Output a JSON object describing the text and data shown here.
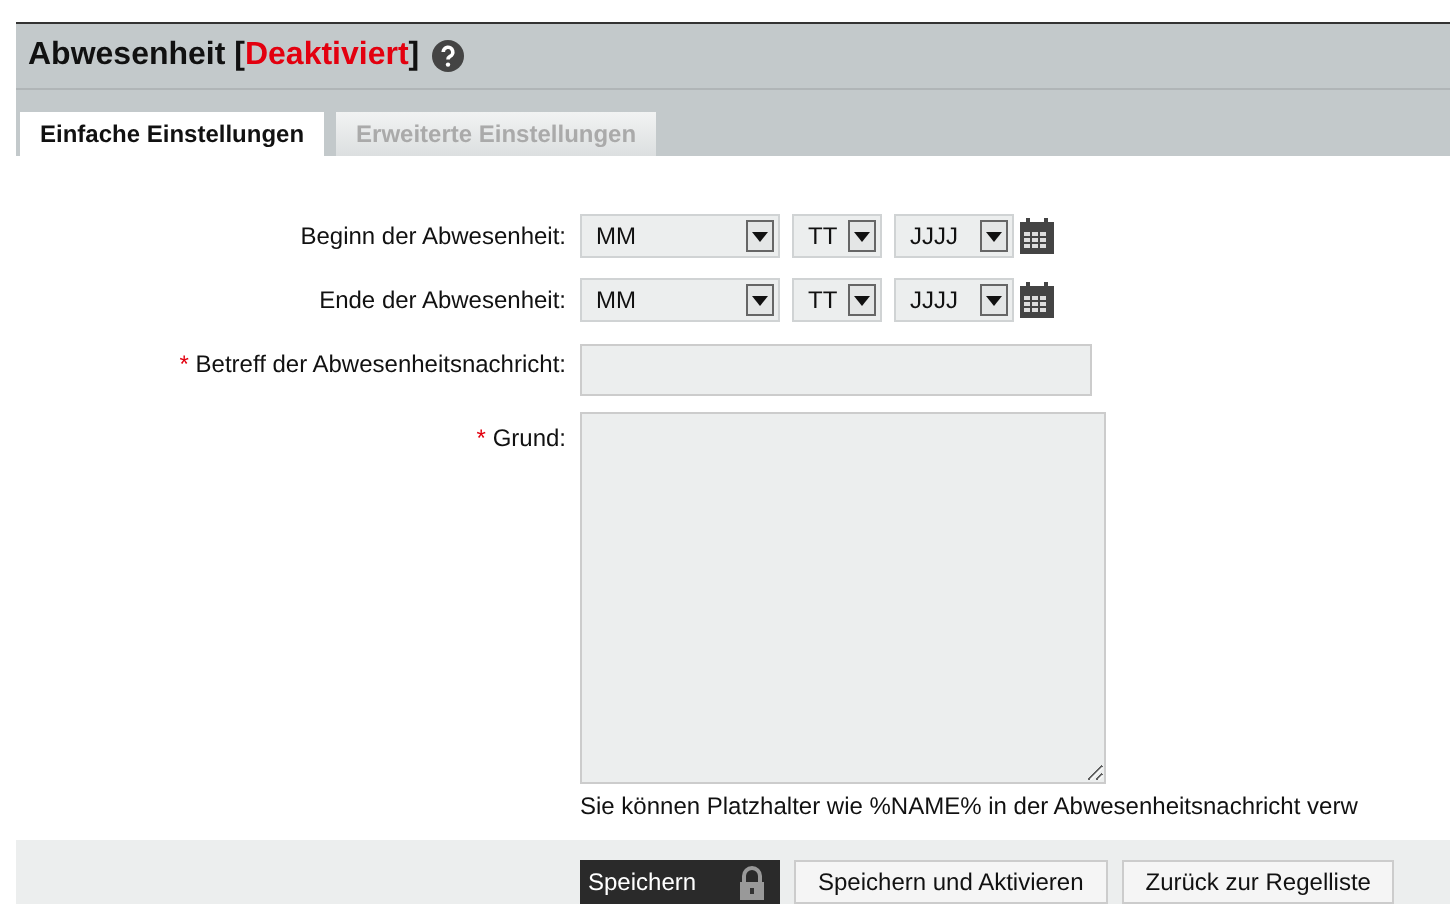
{
  "header": {
    "title": "Abwesenheit",
    "status": "Deaktiviert",
    "open_bracket": "[",
    "close_bracket": "]"
  },
  "tabs": [
    {
      "label": "Einfache Einstellungen",
      "selected": true
    },
    {
      "label": "Erweiterte Einstellungen",
      "selected": false
    }
  ],
  "fields": [
    {
      "kind": "date",
      "label": "Beginn der Abwesenheit:",
      "required": false,
      "parts": [
        "MM",
        "TT",
        "JJJJ"
      ]
    },
    {
      "kind": "date",
      "label": "Ende der Abwesenheit:",
      "required": false,
      "parts": [
        "MM",
        "TT",
        "JJJJ"
      ]
    },
    {
      "kind": "text",
      "label": "Betreff der Abwesenheitsnachricht:",
      "required": true,
      "required_mark": "*"
    },
    {
      "kind": "textarea",
      "label": "Grund:",
      "required": true,
      "required_mark": "*"
    }
  ],
  "hint": "Sie können Platzhalter wie %NAME% in der Abwesenheitsnachricht verw",
  "buttons": [
    {
      "label": "Speichern",
      "kind": "primary"
    },
    {
      "label": "Speichern und Aktivieren",
      "kind": "default"
    },
    {
      "label": "Zurück zur Regelliste",
      "kind": "default"
    }
  ]
}
